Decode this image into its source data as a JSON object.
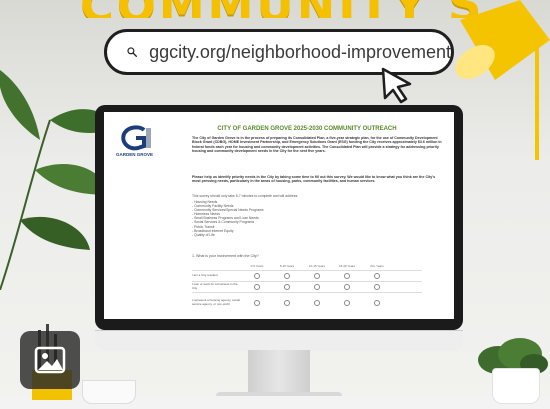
{
  "banner": {
    "text": "COMMUNITY SURVEY"
  },
  "url_bar": {
    "url": "ggcity.org/neighborhood-improvement",
    "icon": "search-icon"
  },
  "document": {
    "logo_caption": "GARDEN GROVE",
    "title": "CITY OF GARDEN GROVE 2025-2030 COMMUNITY OUTREACH",
    "para1": "The City of Garden Grove is in the process of preparing its Consolidated Plan, a five-year strategic plan, for the use of Community Development Block Grant (CDBG), HOME Investment Partnership, and Emergency Solutions Grant (ESG) funding the City receives approximately $3.6 million in federal funds each year for housing and community development activities. The Consolidated Plan will provide a strategy for addressing priority housing and community development needs in the City for the next five years.",
    "para2": "Please help us identify priority needs in the City by taking some time to fill out this survey. We would like to know what you think are the City's most pressing needs, particularly in the areas of housing, parks, community facilities, and human services.",
    "para3": "This survey should only take 5-7 minutes to complete and will address:",
    "list": [
      "- Housing Needs",
      "- Community Facility Needs",
      "- Community Services/Special Needs Programs",
      "- Homeless Needs",
      "- Small Business Programs and Loan Needs",
      "- Social Services & Community Programs",
      "- Public Transit",
      "- Broadband Internet Equity",
      "- Quality of Life"
    ],
    "question": "1. What is your involvement with the City?",
    "grid_columns": [
      "",
      "0-5 Years",
      "5-10 Years",
      "10-15 Years",
      "15-20 Years",
      "20+ Years"
    ],
    "grid_rows": [
      "I am a City resident",
      "I own or work for a business in the City",
      "I represent a housing agency, social service agency, or non-profit"
    ]
  },
  "media_badge": {
    "icon": "image-icon"
  },
  "colors": {
    "accent_yellow": "#f5c000",
    "doc_title_green": "#5a8a2a",
    "logo_blue": "#1b3d7a"
  }
}
